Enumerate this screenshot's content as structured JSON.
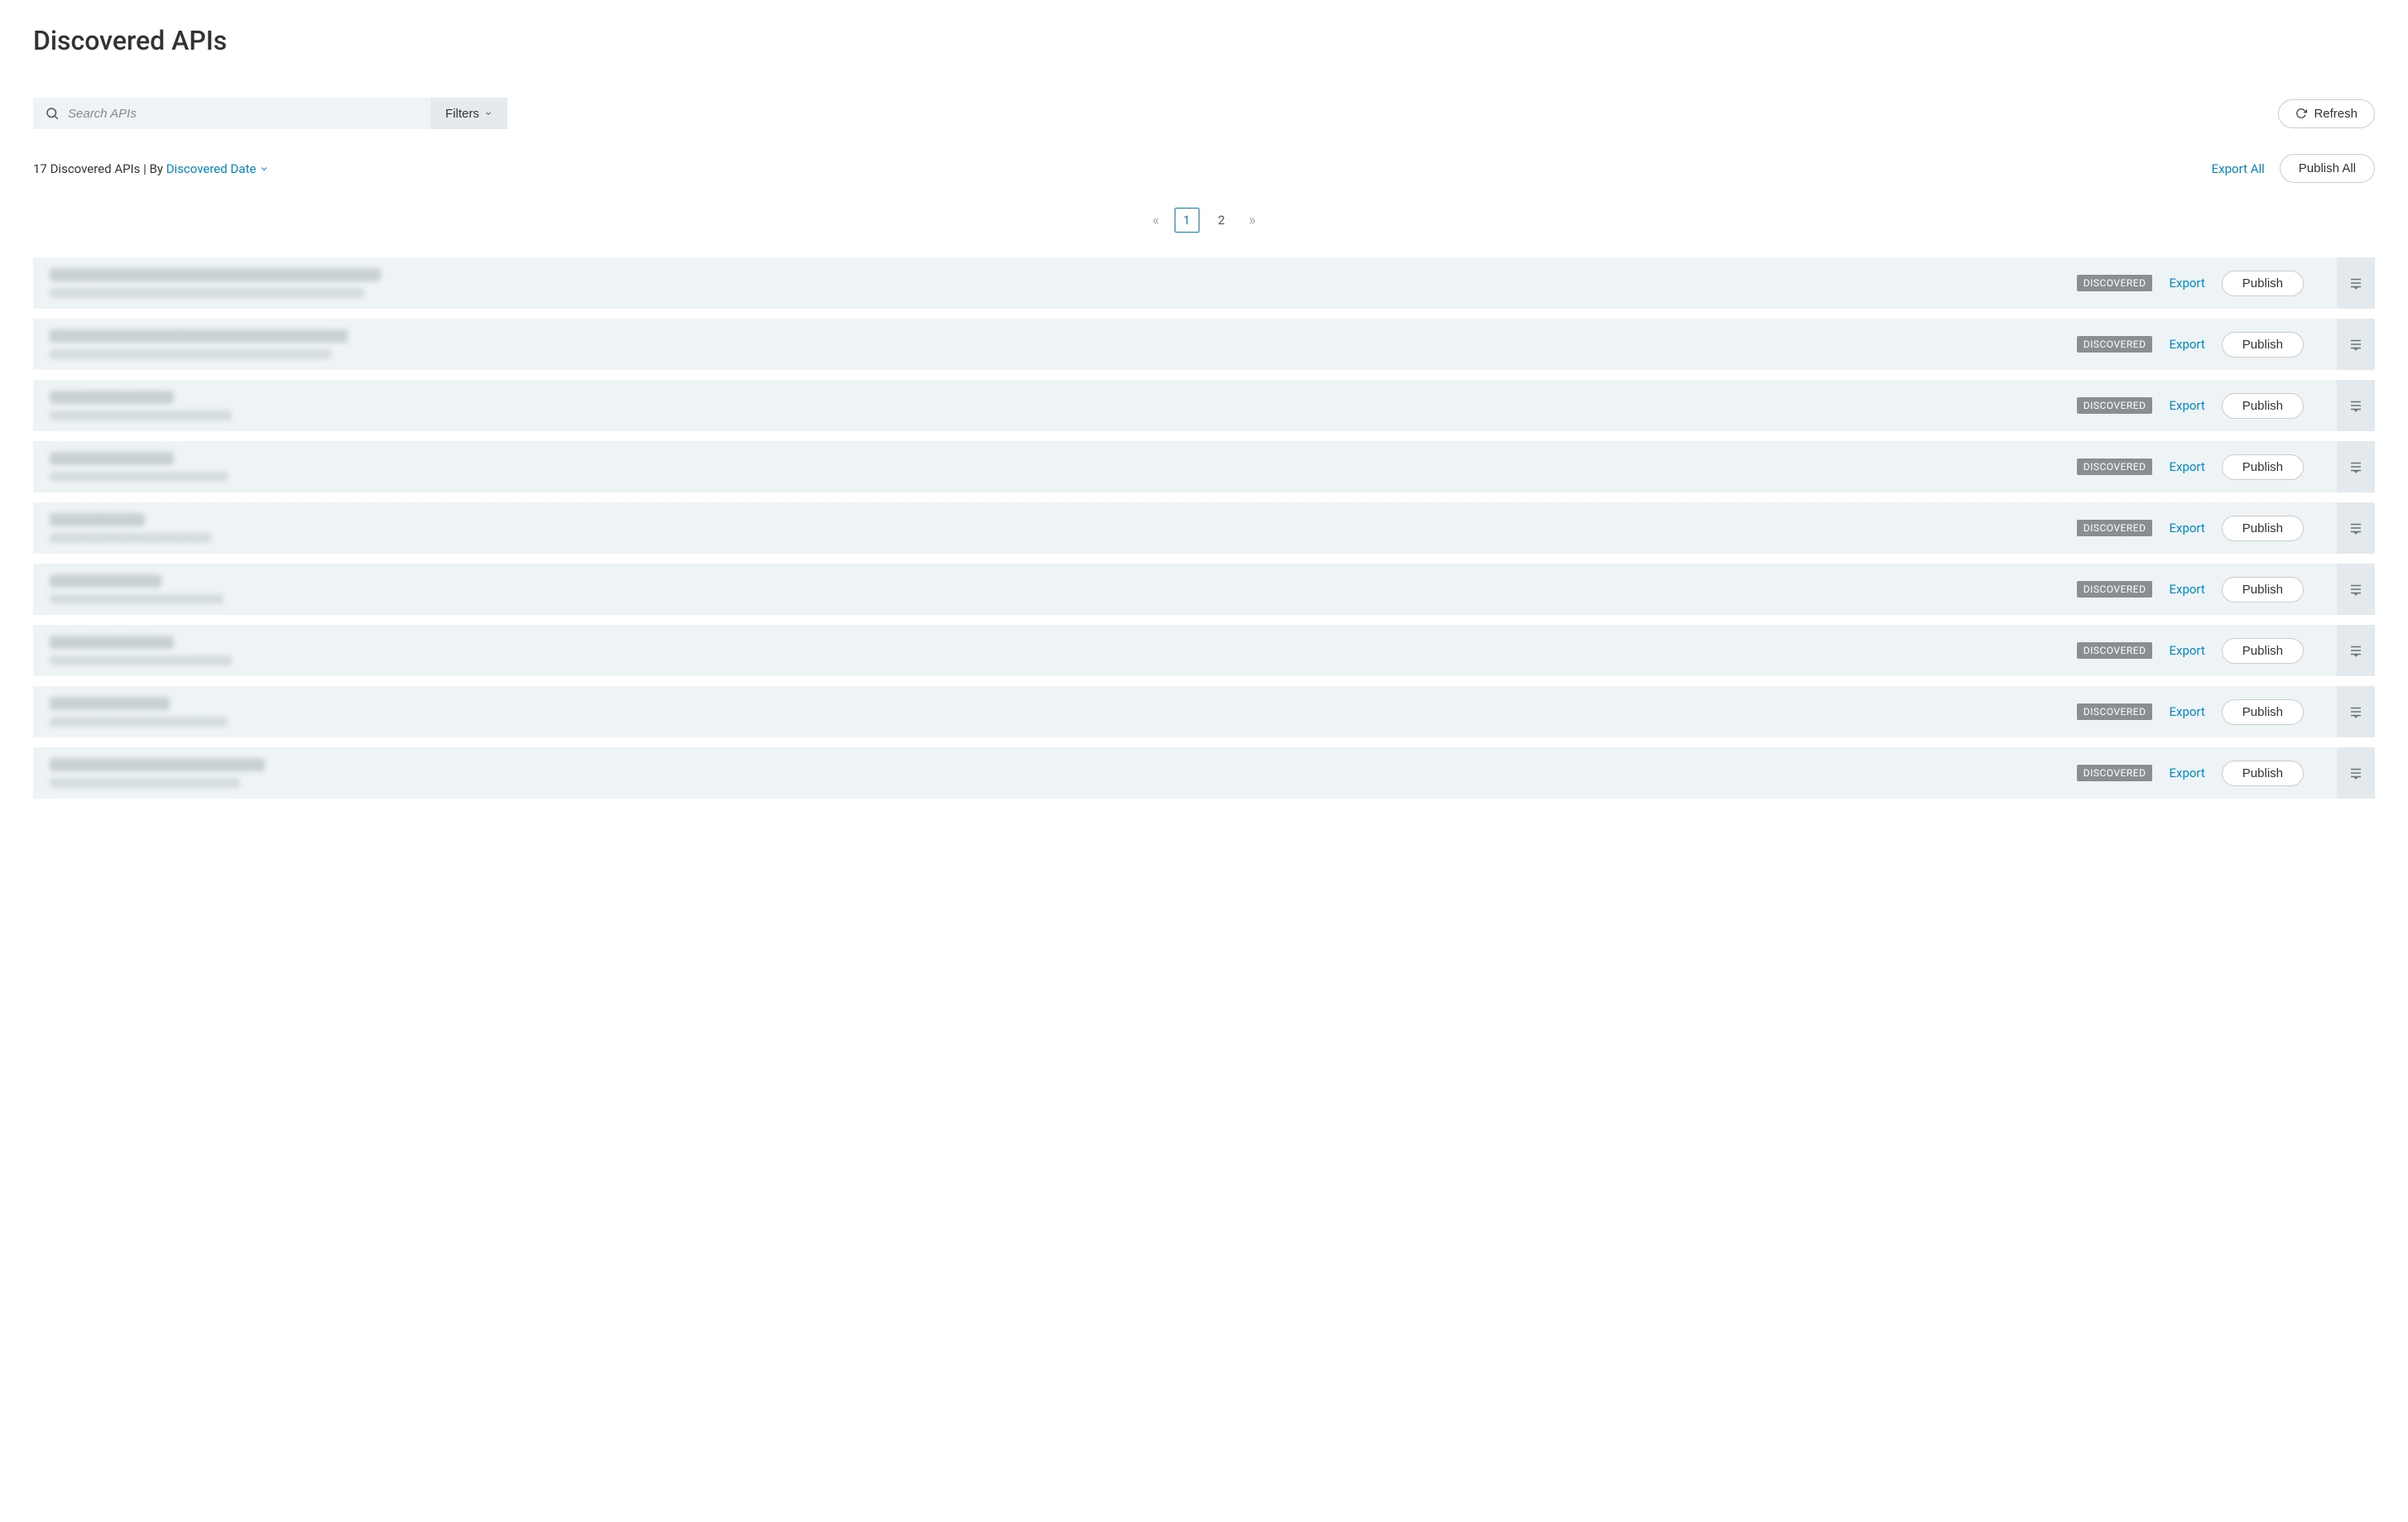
{
  "header": {
    "title": "Discovered APIs"
  },
  "search": {
    "placeholder": "Search APIs",
    "value": "",
    "filters_label": "Filters"
  },
  "actions": {
    "refresh": "Refresh",
    "export_all": "Export All",
    "publish_all": "Publish All"
  },
  "summary": {
    "count_text": "17 Discovered APIs",
    "by_label": "By",
    "sort_label": "Discovered Date"
  },
  "pagination": {
    "pages": [
      "1",
      "2"
    ],
    "current": "1"
  },
  "row_labels": {
    "status": "DISCOVERED",
    "export": "Export",
    "publish": "Publish"
  },
  "rows": [
    {
      "title_width": 400,
      "sub_width": 380
    },
    {
      "title_width": 360,
      "sub_width": 340
    },
    {
      "title_width": 150,
      "sub_width": 220
    },
    {
      "title_width": 150,
      "sub_width": 215
    },
    {
      "title_width": 115,
      "sub_width": 195
    },
    {
      "title_width": 135,
      "sub_width": 210
    },
    {
      "title_width": 150,
      "sub_width": 220
    },
    {
      "title_width": 145,
      "sub_width": 215
    },
    {
      "title_width": 260,
      "sub_width": 230
    }
  ]
}
